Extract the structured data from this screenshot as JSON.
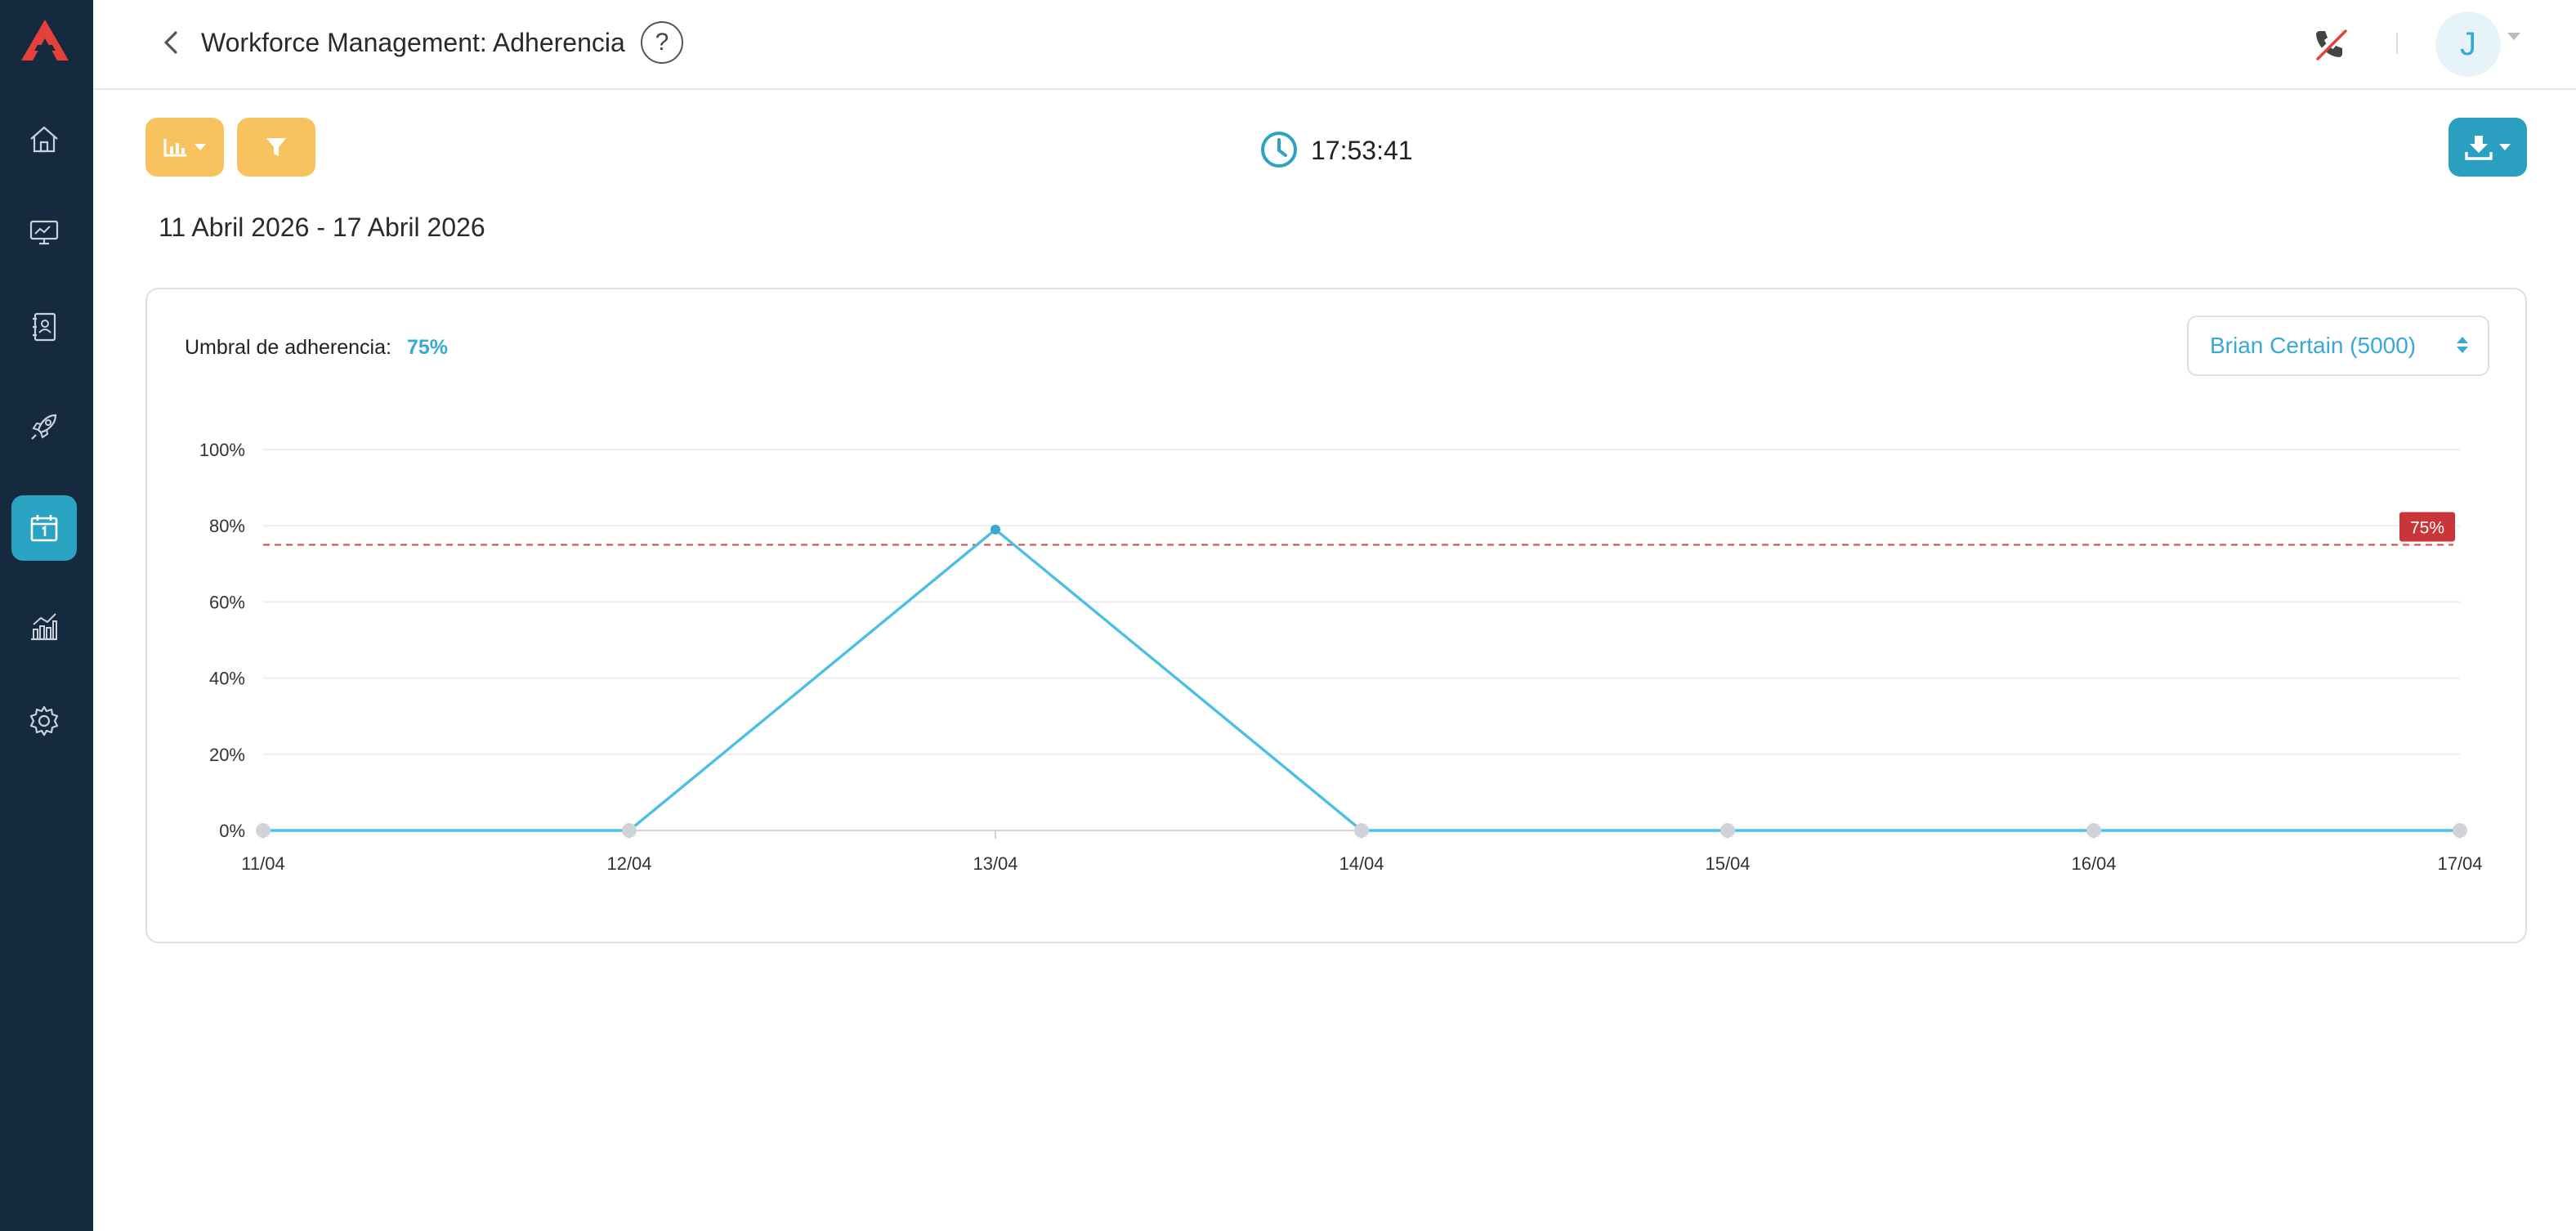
{
  "header": {
    "title": "Workforce Management: Adherencia",
    "help_label": "?",
    "avatar_initial": "J"
  },
  "sidebar": {
    "items": [
      {
        "icon": "home-icon",
        "active": false
      },
      {
        "icon": "monitor-icon",
        "active": false
      },
      {
        "icon": "contacts-book-icon",
        "active": false
      },
      {
        "icon": "rocket-icon",
        "active": false
      },
      {
        "icon": "calendar-icon",
        "active": true
      },
      {
        "icon": "analytics-icon",
        "active": false
      },
      {
        "icon": "gear-icon",
        "active": false
      }
    ]
  },
  "toolbar": {
    "time": "17:53:41"
  },
  "date_range": "11 Abril 2026 - 17 Abril 2026",
  "card": {
    "threshold_label": "Umbral de adherencia:",
    "threshold_value": "75%",
    "agent_select_value": "Brian Certain (5000)"
  },
  "colors": {
    "sidebar_bg": "#15293f",
    "accent": "#36a9d6",
    "toolbar_button": "#f8c35f",
    "download_button": "#2a9fbf",
    "threshold_line": "#d9453f",
    "series_line": "#4cc0e3"
  },
  "chart_data": {
    "type": "line",
    "x": [
      "11/04",
      "12/04",
      "13/04",
      "14/04",
      "15/04",
      "16/04",
      "17/04"
    ],
    "series": [
      {
        "values": [
          0,
          0,
          79,
          0,
          0,
          0,
          0
        ]
      }
    ],
    "ylim": [
      0,
      100
    ],
    "y_ticks": [
      "0%",
      "20%",
      "40%",
      "60%",
      "80%",
      "100%"
    ],
    "threshold": 75,
    "threshold_label": "75%",
    "grid": true
  }
}
